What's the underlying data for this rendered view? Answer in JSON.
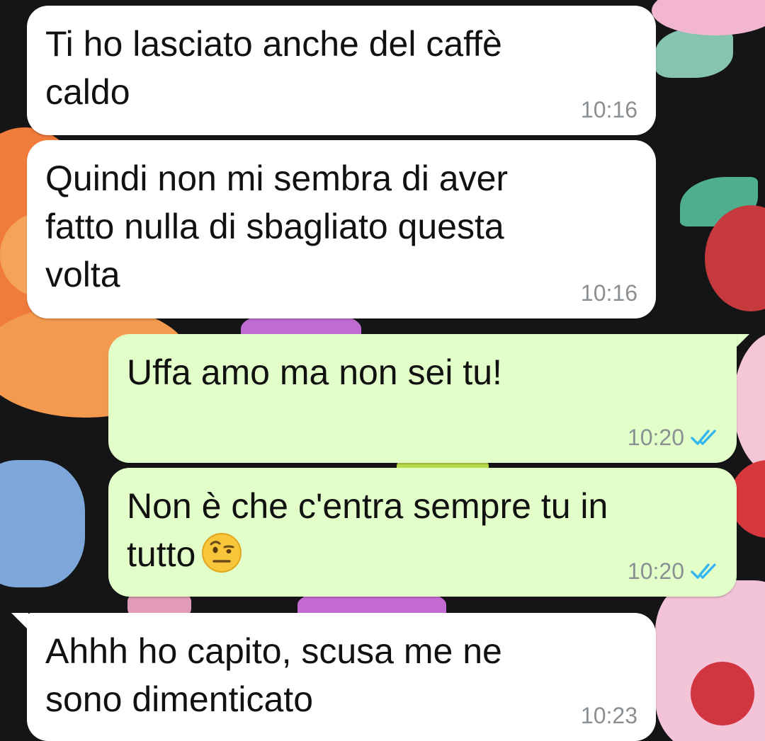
{
  "colors": {
    "incoming_bubble": "#ffffff",
    "outgoing_bubble": "#e2ffc9",
    "timestamp": "#8a8f93",
    "read_ticks": "#34b7f1"
  },
  "messages": [
    {
      "direction": "incoming",
      "text": "Ti ho lasciato anche del caffè\ncaldo",
      "time": "10:16"
    },
    {
      "direction": "incoming",
      "text": "Quindi non mi sembra di aver\nfatto nulla di sbagliato questa\nvolta",
      "time": "10:16"
    },
    {
      "direction": "outgoing",
      "text": "Uffa amo ma non sei tu!",
      "time": "10:20",
      "status_icon": "double-check-icon"
    },
    {
      "direction": "outgoing",
      "text": "Non è che c'entra sempre tu in\ntutto",
      "emoji": "face-with-raised-eyebrow",
      "time": "10:20",
      "status_icon": "double-check-icon"
    },
    {
      "direction": "incoming",
      "text": "Ahhh ho capito, scusa me ne\nsono dimenticato",
      "time": "10:23"
    }
  ]
}
